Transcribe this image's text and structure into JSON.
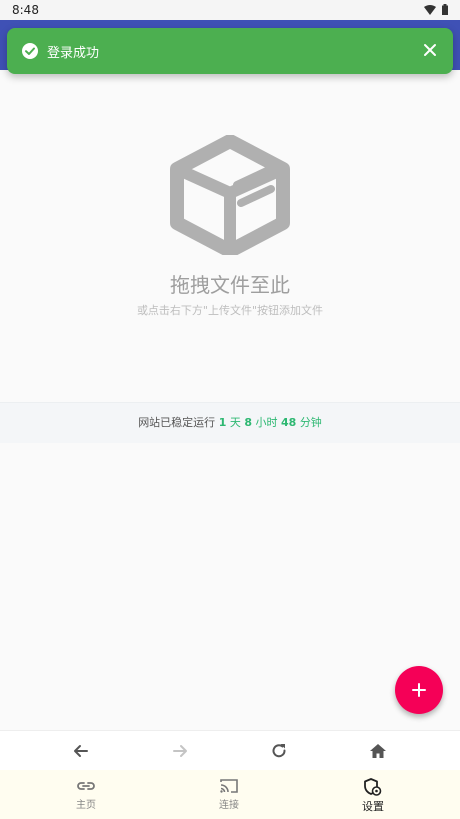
{
  "status_bar": {
    "time": "8:48"
  },
  "toast": {
    "message": "登录成功",
    "icon": "check-circle-icon",
    "color": "#4caf50"
  },
  "app_bar": {
    "color": "#3f51b5"
  },
  "empty_state": {
    "icon": "box-icon",
    "title": "拖拽文件至此",
    "subtitle": "或点击右下方\"上传文件\"按钮添加文件"
  },
  "uptime": {
    "prefix": "网站已稳定运行",
    "days": "1",
    "days_unit": "天",
    "hours": "8",
    "hours_unit": "小时",
    "minutes": "48",
    "minutes_unit": "分钟"
  },
  "fab": {
    "icon": "plus-icon",
    "color": "#f50057"
  },
  "browser_nav": {
    "icons": [
      "back-arrow-icon",
      "forward-arrow-icon",
      "refresh-icon",
      "home-icon"
    ]
  },
  "bottom_nav": {
    "tabs": [
      {
        "label": "主页",
        "icon": "link-icon"
      },
      {
        "label": "连接",
        "icon": "cast-icon"
      },
      {
        "label": "设置",
        "icon": "settings-shield-icon",
        "active": true
      }
    ]
  }
}
